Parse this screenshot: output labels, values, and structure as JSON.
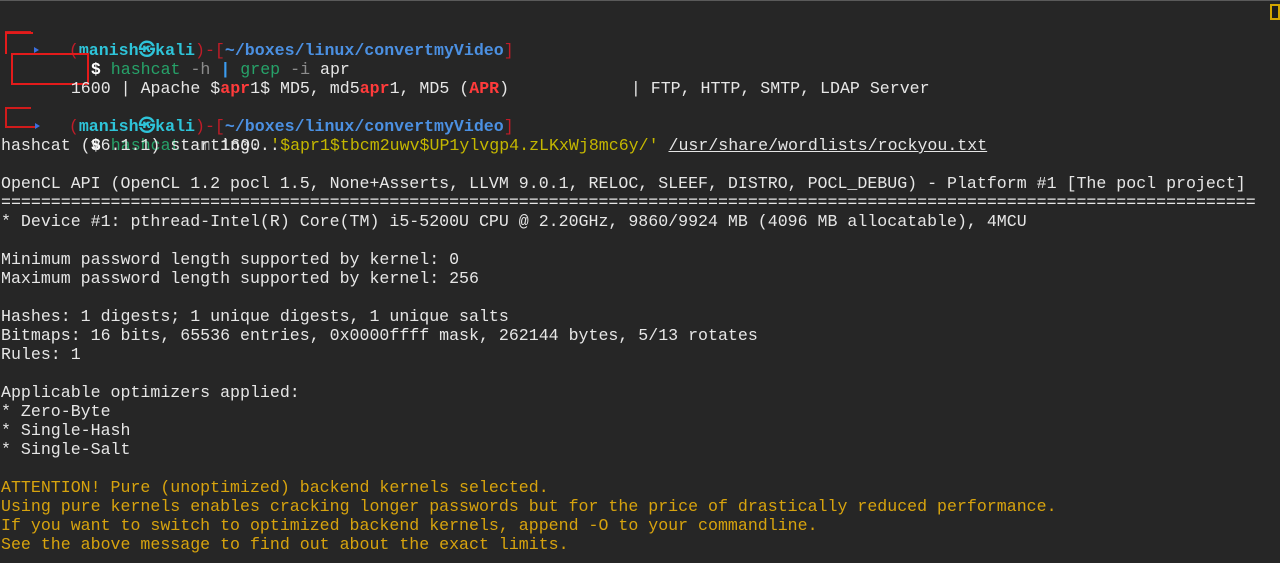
{
  "prompt1": {
    "user": "manish",
    "at_symbol": "㉿",
    "host": "kali",
    "dir": "~/boxes/linux/convertmyVideo",
    "symbol": "$",
    "cmd_name": "hashcat",
    "cmd_flag": "-h",
    "pipe": "|",
    "grep": "grep",
    "grep_flag": "-i",
    "grep_arg": "apr"
  },
  "grep_result": {
    "mode": "1600",
    "sep1": "|",
    "name_a": "Apache $",
    "hl1": "apr",
    "name_b": "1$ MD5, md5",
    "hl2": "apr",
    "name_c": "1, MD5 (",
    "hl3": "APR",
    "name_d": ")",
    "sep2": "| FTP, HTTP, SMTP, LDAP Server"
  },
  "prompt2": {
    "user": "manish",
    "at_symbol": "㉿",
    "host": "kali",
    "dir": "~/boxes/linux/convertmyVideo",
    "symbol": "$",
    "cmd_name": "hashcat",
    "cmd_flag": "-m",
    "cmd_mode": "1600",
    "hash_arg": "'$apr1$tbcm2uwv$UP1ylvgp4.zLKxWj8mc6y/'",
    "wordlist": "/usr/share/wordlists/rockyou.txt"
  },
  "output": [
    {
      "text": "hashcat (v6.1.1) starting...",
      "kind": "normal"
    },
    {
      "text": "",
      "kind": "normal"
    },
    {
      "text": "OpenCL API (OpenCL 1.2 pocl 1.5, None+Asserts, LLVM 9.0.1, RELOC, SLEEF, DISTRO, POCL_DEBUG) - Platform #1 [The pocl project]",
      "kind": "normal"
    },
    {
      "text": "==============================================================================================================================",
      "kind": "normal"
    },
    {
      "text": "* Device #1: pthread-Intel(R) Core(TM) i5-5200U CPU @ 2.20GHz, 9860/9924 MB (4096 MB allocatable), 4MCU",
      "kind": "normal"
    },
    {
      "text": "",
      "kind": "normal"
    },
    {
      "text": "Minimum password length supported by kernel: 0",
      "kind": "normal"
    },
    {
      "text": "Maximum password length supported by kernel: 256",
      "kind": "normal"
    },
    {
      "text": "",
      "kind": "normal"
    },
    {
      "text": "Hashes: 1 digests; 1 unique digests, 1 unique salts",
      "kind": "normal"
    },
    {
      "text": "Bitmaps: 16 bits, 65536 entries, 0x0000ffff mask, 262144 bytes, 5/13 rotates",
      "kind": "normal"
    },
    {
      "text": "Rules: 1",
      "kind": "normal"
    },
    {
      "text": "",
      "kind": "normal"
    },
    {
      "text": "Applicable optimizers applied:",
      "kind": "normal"
    },
    {
      "text": "* Zero-Byte",
      "kind": "normal"
    },
    {
      "text": "* Single-Hash",
      "kind": "normal"
    },
    {
      "text": "* Single-Salt",
      "kind": "normal"
    },
    {
      "text": "",
      "kind": "normal"
    },
    {
      "text": "ATTENTION! Pure (unoptimized) backend kernels selected.",
      "kind": "warn"
    },
    {
      "text": "Using pure kernels enables cracking longer passwords but for the price of drastically reduced performance.",
      "kind": "warn"
    },
    {
      "text": "If you want to switch to optimized backend kernels, append -O to your commandline.",
      "kind": "warn"
    },
    {
      "text": "See the above message to find out about the exact limits.",
      "kind": "warn"
    }
  ]
}
